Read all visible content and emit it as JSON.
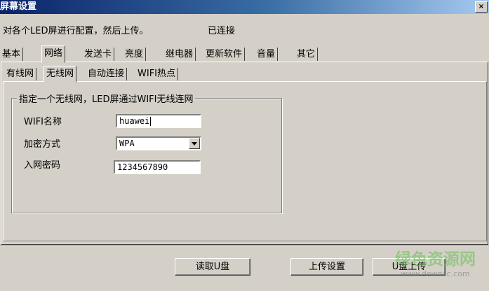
{
  "window": {
    "title": "屏幕设置",
    "close_glyph": "×"
  },
  "intro_text": "对各个LED屏进行配置，然后上传。",
  "status_text": "已连接",
  "main_tabs": [
    "基本",
    "网络",
    "发送卡",
    "亮度",
    "继电器",
    "更新软件",
    "音量",
    "其它"
  ],
  "main_tab_selected": "网络",
  "network_tabs": [
    "有线网",
    "无线网",
    "自动连接",
    "WIFI热点"
  ],
  "network_tab_selected": "无线网",
  "wireless": {
    "group_title": "指定一个无线网，LED屏通过WIFI无线连网",
    "wifi_name_label": "WIFI名称",
    "wifi_name_value": "huawei",
    "encryption_label": "加密方式",
    "encryption_value": "WPA",
    "password_label": "入网密码",
    "password_value": "1234567890"
  },
  "buttons": {
    "read_usb": "读取U盘",
    "upload_settings": "上传设置",
    "usb_upload": "U盘上传"
  },
  "watermark": {
    "text": "绿色资源网",
    "url": "www.downcc.com"
  },
  "colors": {
    "title_start": "#0a246a",
    "title_end": "#a6caf0",
    "face": "#d4d0c8"
  }
}
